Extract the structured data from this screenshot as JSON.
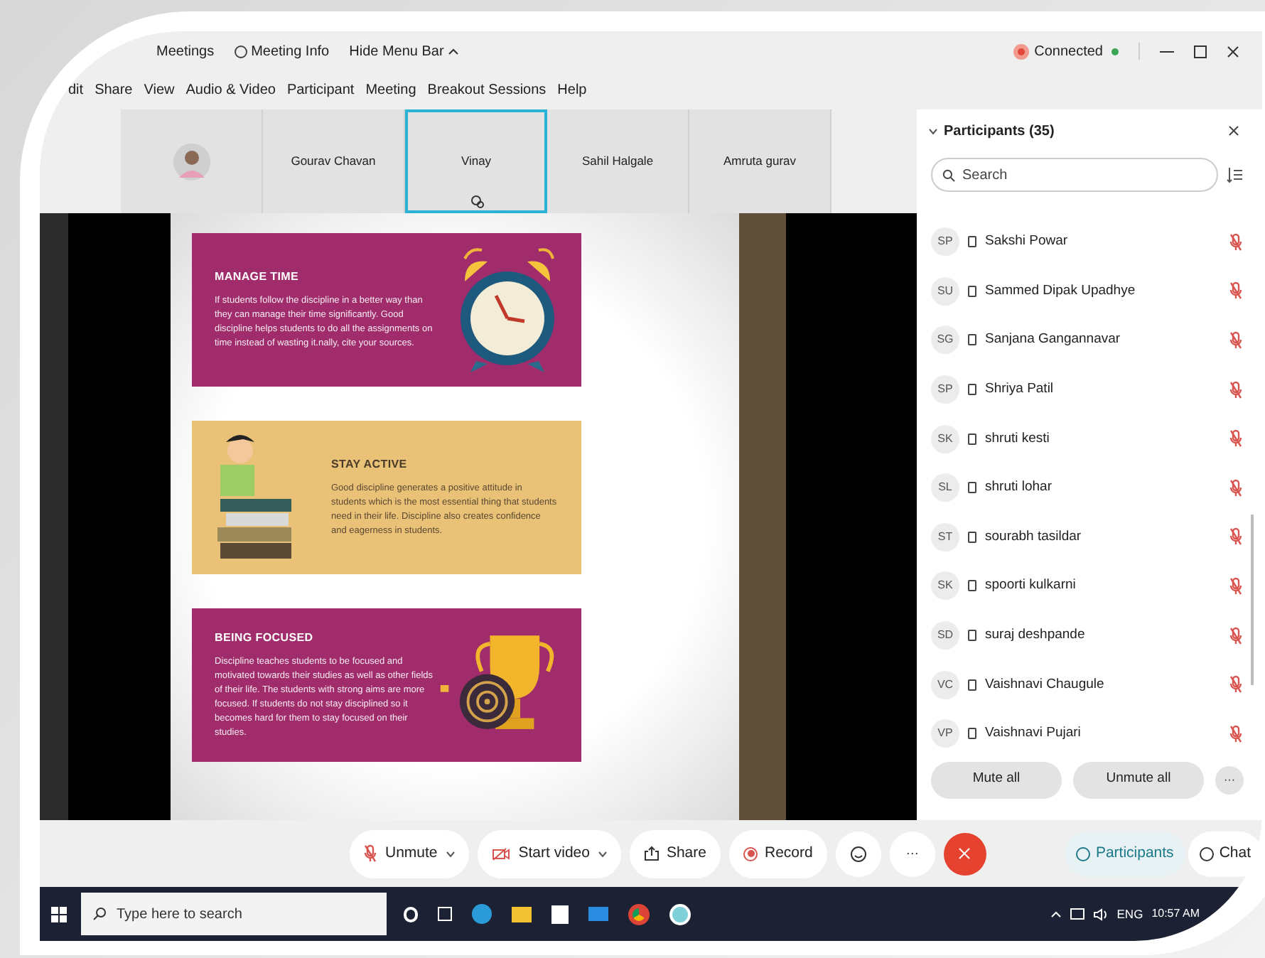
{
  "title_bar": {
    "app": "Meetings",
    "meeting_info": "Meeting Info",
    "hide_menu": "Hide Menu Bar",
    "status": "Connected",
    "connected": true
  },
  "menu": [
    "dit",
    "Share",
    "View",
    "Audio & Video",
    "Participant",
    "Meeting",
    "Breakout Sessions",
    "Help"
  ],
  "thumbnails": [
    {
      "kind": "avatar",
      "selected": false
    },
    {
      "kind": "name",
      "name": "Gourav Chavan",
      "selected": false
    },
    {
      "kind": "name",
      "name": "Vinay",
      "selected": true
    },
    {
      "kind": "name",
      "name": "Sahil Halgale",
      "selected": false
    },
    {
      "kind": "name",
      "name": "Amruta gurav",
      "selected": false
    }
  ],
  "slide": {
    "cards": [
      {
        "kind": "clock",
        "title": "MANAGE TIME",
        "text": "If students follow the discipline in a better way than they can manage their time significantly. Good discipline helps students to do all the assignments on time instead of wasting it.nally, cite your sources."
      },
      {
        "kind": "books",
        "title": "STAY ACTIVE",
        "text": "Good discipline generates a positive attitude in students which is the most essential thing that students need in their life. Discipline also creates confidence and eagerness in students."
      },
      {
        "kind": "trophy",
        "title": "BEING FOCUSED",
        "text": "Discipline teaches students to be focused and motivated towards their studies as well as other fields of their life. The students with strong aims are more focused. If students do not stay disciplined so it becomes hard for them to stay focused on their studies."
      }
    ]
  },
  "participants_panel": {
    "title": "Participants (35)",
    "search": {
      "placeholder": "Search"
    },
    "participants": [
      {
        "initials": "SP",
        "name": "Sakshi Powar",
        "muted": true
      },
      {
        "initials": "SU",
        "name": "Sammed Dipak Upadhye",
        "muted": true
      },
      {
        "initials": "SG",
        "name": "Sanjana Gangannavar",
        "muted": true
      },
      {
        "initials": "SP",
        "name": "Shriya Patil",
        "muted": true
      },
      {
        "initials": "SK",
        "name": "shruti kesti",
        "muted": true
      },
      {
        "initials": "SL",
        "name": "shruti lohar",
        "muted": true
      },
      {
        "initials": "ST",
        "name": "sourabh tasildar",
        "muted": true
      },
      {
        "initials": "SK",
        "name": "spoorti kulkarni",
        "muted": true
      },
      {
        "initials": "SD",
        "name": "suraj deshpande",
        "muted": true
      },
      {
        "initials": "VC",
        "name": "Vaishnavi Chaugule",
        "muted": true
      },
      {
        "initials": "VP",
        "name": "Vaishnavi Pujari",
        "muted": true
      }
    ],
    "buttons": [
      "Mute all",
      "Unmute all",
      "···"
    ]
  },
  "controls": {
    "unmute": "Unmute",
    "start_video": "Start video",
    "share": "Share",
    "record": "Record",
    "more": "···"
  },
  "side_tabs": [
    {
      "label": "Participants",
      "selected": true
    },
    {
      "label": "Chat",
      "selected": false
    }
  ],
  "taskbar": {
    "search": {
      "placeholder": "Type here to search"
    },
    "language": "ENG",
    "time": "10:57 AM"
  }
}
